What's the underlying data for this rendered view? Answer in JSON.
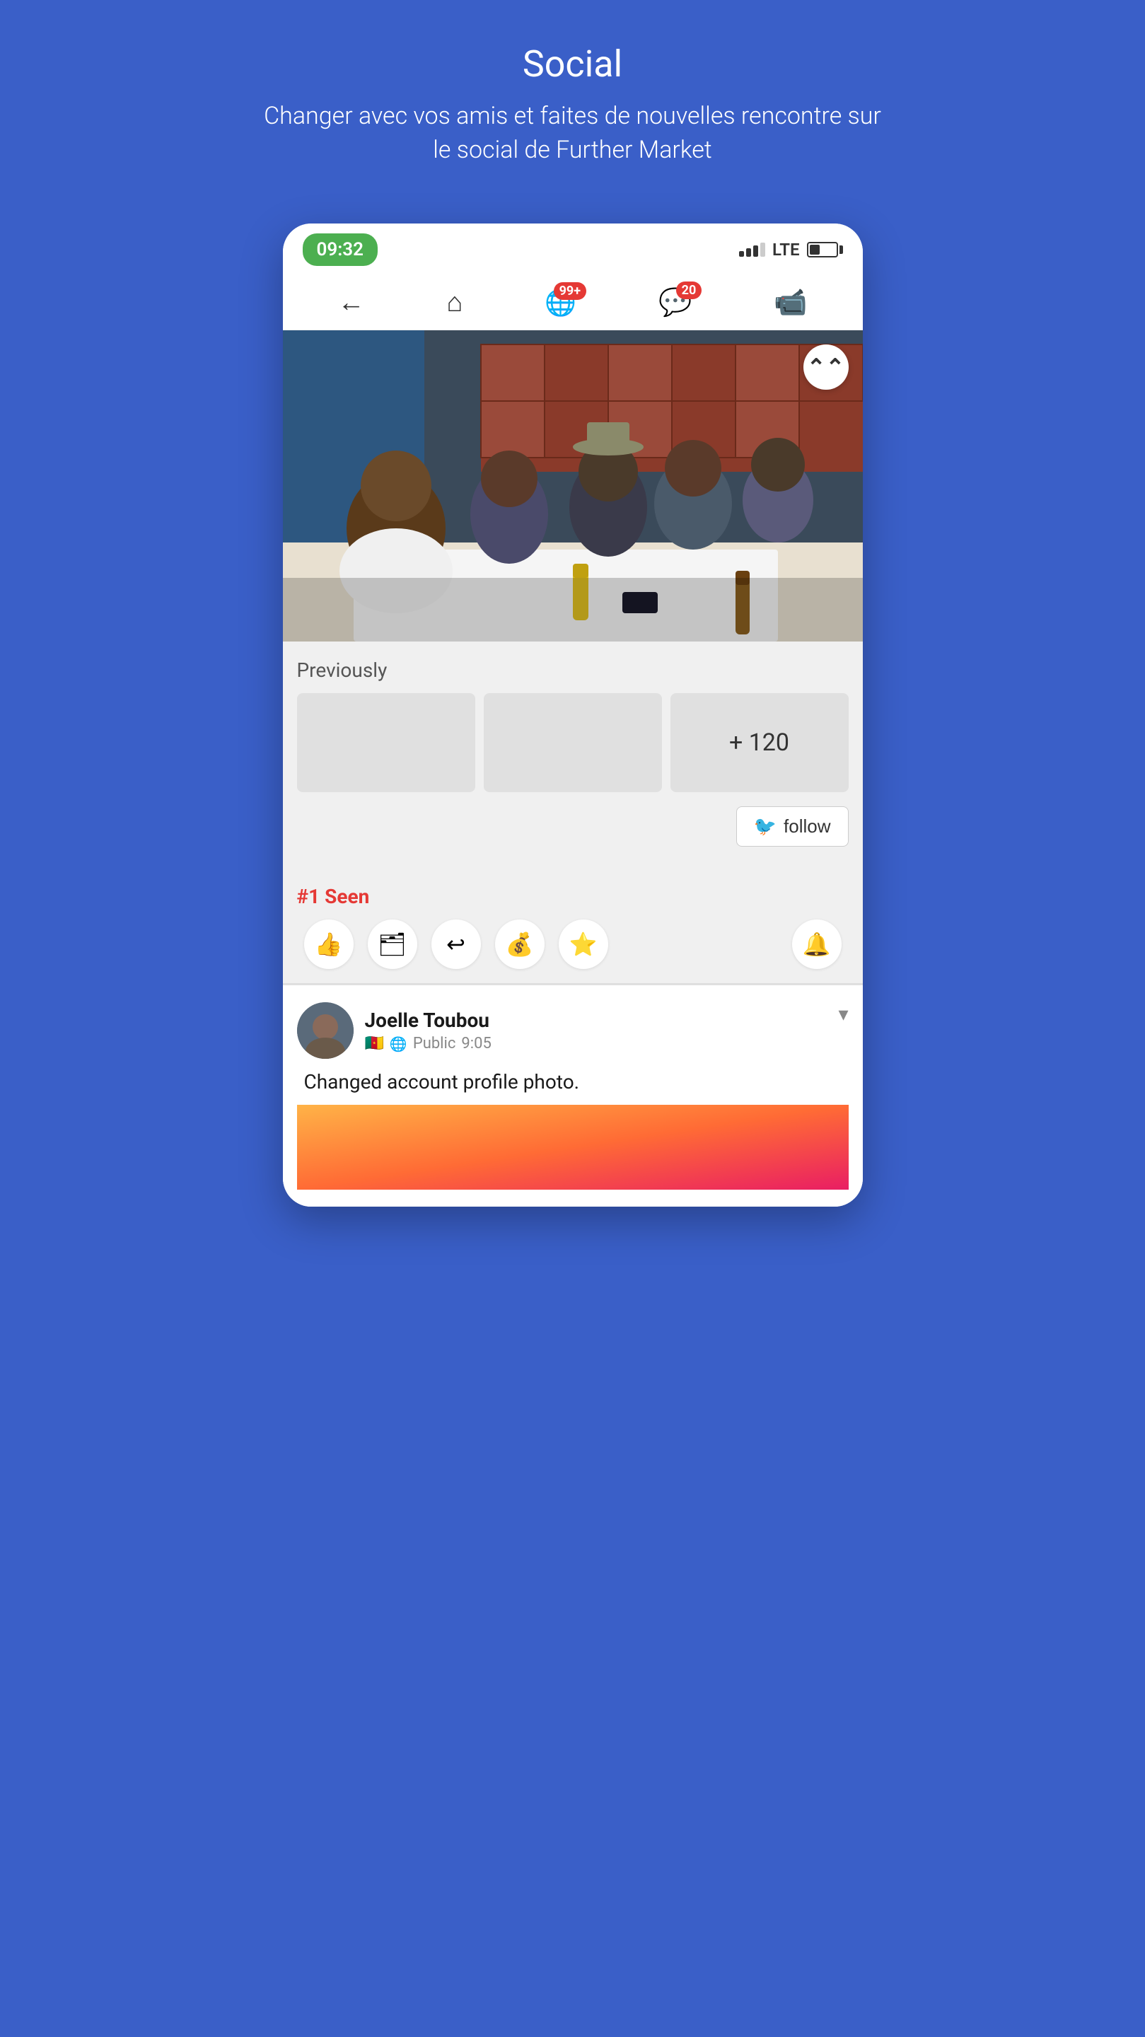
{
  "page": {
    "title": "Social",
    "subtitle": "Changer avec vos amis et faites de nouvelles rencontre sur le social de Further Market"
  },
  "status_bar": {
    "time": "09:32",
    "lte": "LTE"
  },
  "nav": {
    "back_label": "←",
    "home_label": "🏠",
    "notifications_count": "99+",
    "messages_count": "20",
    "video_label": "📹"
  },
  "main_post": {
    "scroll_up_label": "⌃⌃",
    "previously_label": "Previously",
    "more_count": "+ 120",
    "follow_label": "follow",
    "seen_label": "#1 Seen"
  },
  "action_icons": {
    "like": "👍",
    "repost": "🗂",
    "share": "↩",
    "money": "💰",
    "star": "⭐",
    "bell": "🔔"
  },
  "next_post": {
    "user_name": "Joelle Toubou",
    "user_flag": "🇨🇲",
    "visibility": "Public",
    "time": "9:05",
    "post_text": "Changed account profile photo."
  }
}
